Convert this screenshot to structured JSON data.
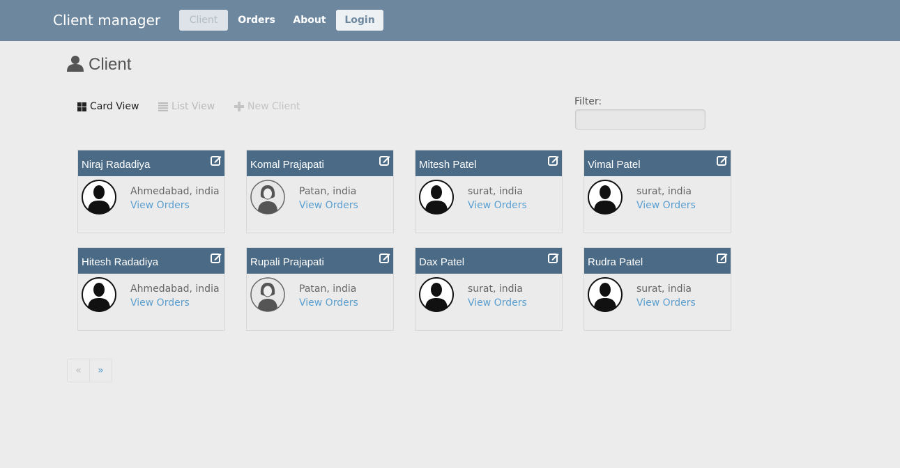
{
  "navbar": {
    "brand": "Client manager",
    "items": [
      {
        "label": "Client"
      },
      {
        "label": "Orders"
      },
      {
        "label": "About"
      },
      {
        "label": "Login"
      }
    ]
  },
  "page": {
    "title": "Client",
    "title_icon": "user-icon"
  },
  "toolbar": {
    "card_view": "Card View",
    "list_view": "List View",
    "new_client": "New Client",
    "filter_label": "Filter:",
    "filter_value": ""
  },
  "clients": [
    {
      "name": "Niraj Radadiya",
      "location": "Ahmedabad, india",
      "link": "View Orders",
      "gender": "male"
    },
    {
      "name": "Komal Prajapati",
      "location": "Patan, india",
      "link": "View Orders",
      "gender": "female"
    },
    {
      "name": "Mitesh Patel",
      "location": "surat, india",
      "link": "View Orders",
      "gender": "male"
    },
    {
      "name": "Vimal Patel",
      "location": "surat, india",
      "link": "View Orders",
      "gender": "male"
    },
    {
      "name": "Hitesh Radadiya",
      "location": "Ahmedabad, india",
      "link": "View Orders",
      "gender": "male"
    },
    {
      "name": "Rupali Prajapati",
      "location": "Patan, india",
      "link": "View Orders",
      "gender": "female"
    },
    {
      "name": "Dax Patel",
      "location": "surat, india",
      "link": "View Orders",
      "gender": "male"
    },
    {
      "name": "Rudra Patel",
      "location": "surat, india",
      "link": "View Orders",
      "gender": "male"
    }
  ],
  "pager": {
    "prev": "«",
    "next": "»"
  },
  "colors": {
    "navbar": "#6d879e",
    "card_header": "#4a6a86",
    "link": "#5a9fd0"
  }
}
